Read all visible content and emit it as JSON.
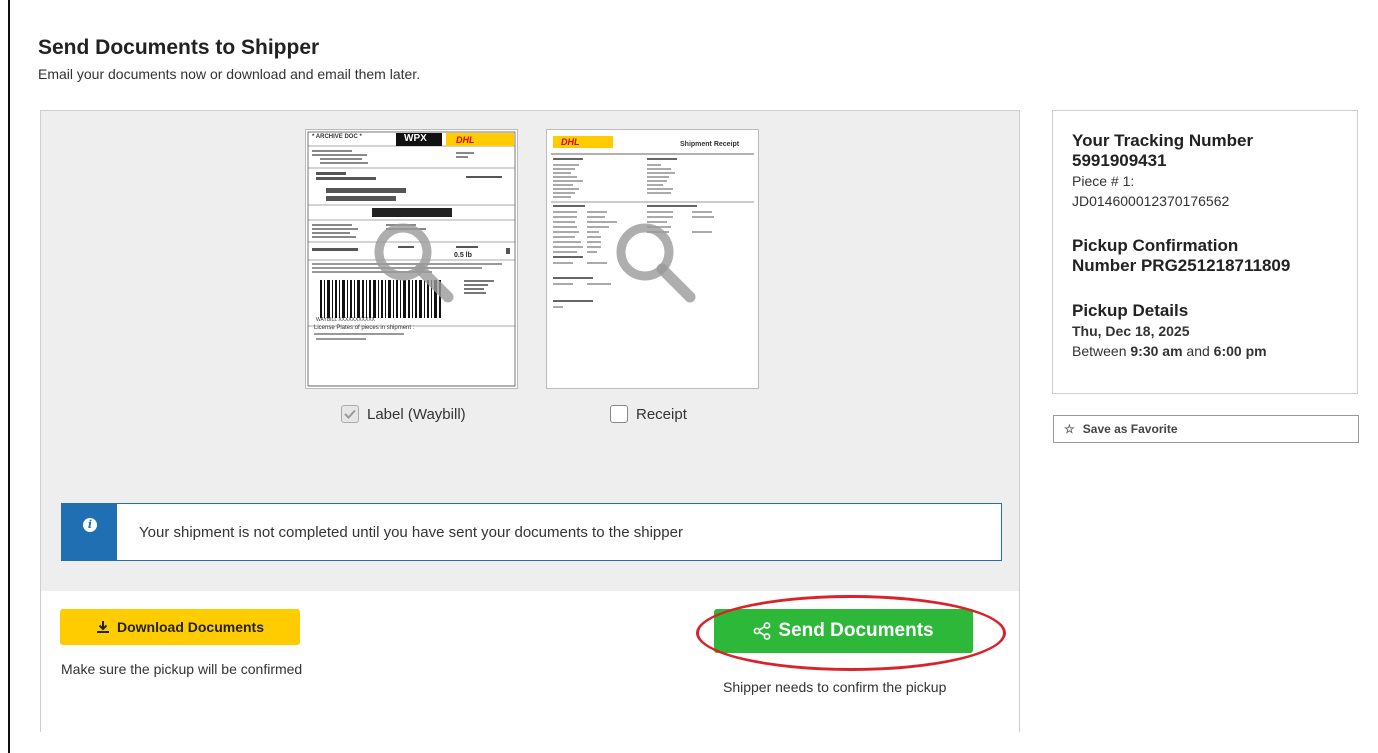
{
  "header": {
    "title": "Send Documents to Shipper",
    "subtitle": "Email your documents now or download and email them later."
  },
  "documents": {
    "label": {
      "name": "Label (Waybill)",
      "checked": true,
      "header_text": "* ARCHIVE DOC *",
      "product_code": "WPX",
      "brand": "DHL",
      "weight": "0.5 lb",
      "waybill_text": "WAYBILL XXXXXXXXXXX",
      "license_text": "License Plates of pieces in shipment :"
    },
    "receipt": {
      "name": "Receipt",
      "checked": false,
      "brand": "DHL",
      "heading": "Shipment Receipt"
    }
  },
  "alert": {
    "icon": "info-icon",
    "message": "Your shipment is not completed until you have sent your documents to the shipper"
  },
  "actions": {
    "download_label": "Download Documents",
    "download_note": "Make sure the pickup will be confirmed",
    "send_label": "Send Documents",
    "send_note": "Shipper needs to confirm the pickup"
  },
  "sidebar": {
    "tracking_heading": "Your Tracking Number",
    "tracking_number": "5991909431",
    "piece_label": "Piece # 1:",
    "piece_id": "JD014600012370176562",
    "pickup_conf_heading_1": "Pickup Confirmation",
    "pickup_conf_heading_2": "Number PRG251218711809",
    "pickup_details_heading": "Pickup Details",
    "pickup_date": "Thu, Dec 18, 2025",
    "between_text": "Between",
    "start_time": "9:30 am",
    "and_text": "and",
    "end_time": "6:00 pm",
    "favorite_label": "Save as Favorite"
  },
  "colors": {
    "dhl_yellow": "#ffcc00",
    "dhl_red": "#d40511",
    "send_green": "#2db839",
    "info_blue": "#1f6fb2",
    "highlight_red": "#d8232a"
  }
}
